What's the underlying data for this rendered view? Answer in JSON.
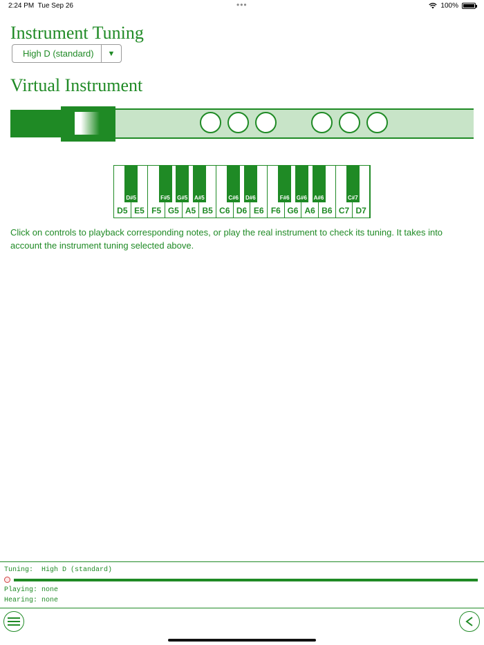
{
  "status_bar": {
    "time": "2:24 PM",
    "date": "Tue Sep 26",
    "dots": "•••",
    "battery": "100%"
  },
  "tuning_section": {
    "title": "Instrument Tuning",
    "selected": "High D (standard)",
    "dropdown_icon": "▼"
  },
  "virtual_section": {
    "title": "Virtual Instrument",
    "holes_count": 6
  },
  "keyboard": {
    "white_keys": [
      "D5",
      "E5",
      "F5",
      "G5",
      "A5",
      "B5",
      "C6",
      "D6",
      "E6",
      "F6",
      "G6",
      "A6",
      "B6",
      "C7",
      "D7"
    ],
    "black_keys": [
      {
        "label": "D#5",
        "after": 0
      },
      {
        "label": "F#5",
        "after": 2
      },
      {
        "label": "G#5",
        "after": 3
      },
      {
        "label": "A#5",
        "after": 4
      },
      {
        "label": "C#6",
        "after": 6
      },
      {
        "label": "D#6",
        "after": 7
      },
      {
        "label": "F#6",
        "after": 9
      },
      {
        "label": "G#6",
        "after": 10
      },
      {
        "label": "A#6",
        "after": 11
      },
      {
        "label": "C#7",
        "after": 13
      }
    ]
  },
  "description": "Click on controls to playback corresponding notes, or play the real instrument to check its tuning. It takes into account the instrument tuning selected above.",
  "console": {
    "tuning_label": "Tuning:",
    "tuning_value": "High D (standard)",
    "playing_label": "Playing:",
    "playing_value": "none",
    "hearing_label": "Hearing:",
    "hearing_value": "none"
  },
  "colors": {
    "accent": "#1f8a25",
    "flute_body": "#c8e4c8"
  },
  "icons": {
    "menu": "menu-icon",
    "back": "back-arrow-icon"
  }
}
